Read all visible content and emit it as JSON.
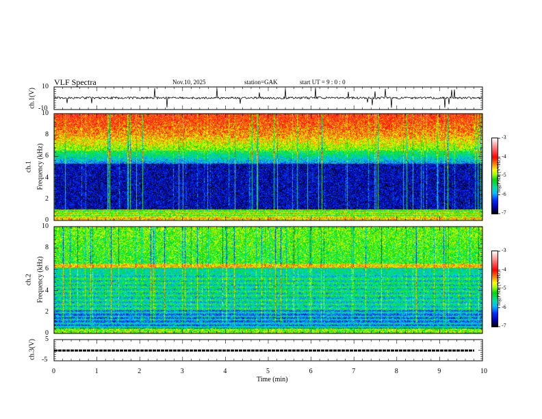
{
  "header": {
    "title": "VLF  Spectra",
    "date": "Nov.10, 2025",
    "station": "station=GAK",
    "start_ut": "start  UT  =    9  : 0   : 0"
  },
  "panels": {
    "ch1_wave": {
      "ylabel": "ch.1(V)",
      "yticks": [
        "10",
        "-10"
      ]
    },
    "ch1_spec": {
      "ylabel_top": "ch.1",
      "ylabel": "Frequency  (kHz)",
      "yticks": [
        "10",
        "8",
        "6",
        "4",
        "2",
        "0"
      ]
    },
    "ch2_spec": {
      "ylabel_top": "ch.2",
      "ylabel": "Frequency  (kHz)",
      "yticks": [
        "10",
        "8",
        "6",
        "4",
        "2",
        "0"
      ]
    },
    "ch3_wave": {
      "ylabel": "ch.3(V)",
      "yticks": [
        "5",
        "-5"
      ]
    }
  },
  "colorbar": {
    "label": "log(PSD) (V²/Hz)",
    "ticks": [
      "-3",
      "-4",
      "-5",
      "-6",
      "-7"
    ],
    "range": [
      -7,
      -3
    ]
  },
  "chart_data": {
    "type": "heatmap",
    "title": "VLF  Spectra",
    "xlabel": "Time  (min)",
    "xticks": [
      "0",
      "1",
      "2",
      "3",
      "4",
      "5",
      "6",
      "7",
      "8",
      "9",
      "10"
    ],
    "xlim": [
      0,
      10
    ],
    "series": [
      {
        "name": "ch.1(V)",
        "type": "line",
        "ylim": [
          -10,
          10
        ],
        "baseline": 0
      },
      {
        "name": "ch.1 spectrogram",
        "type": "heatmap",
        "ylim_khz": [
          0,
          10
        ],
        "log_psd_range": [
          -7,
          -3
        ]
      },
      {
        "name": "ch.2 spectrogram",
        "type": "heatmap",
        "ylim_khz": [
          0,
          10
        ],
        "log_psd_range": [
          -7,
          -3
        ]
      },
      {
        "name": "ch.3(V)",
        "type": "line",
        "ylim": [
          -5,
          5
        ],
        "level": -1
      }
    ]
  }
}
